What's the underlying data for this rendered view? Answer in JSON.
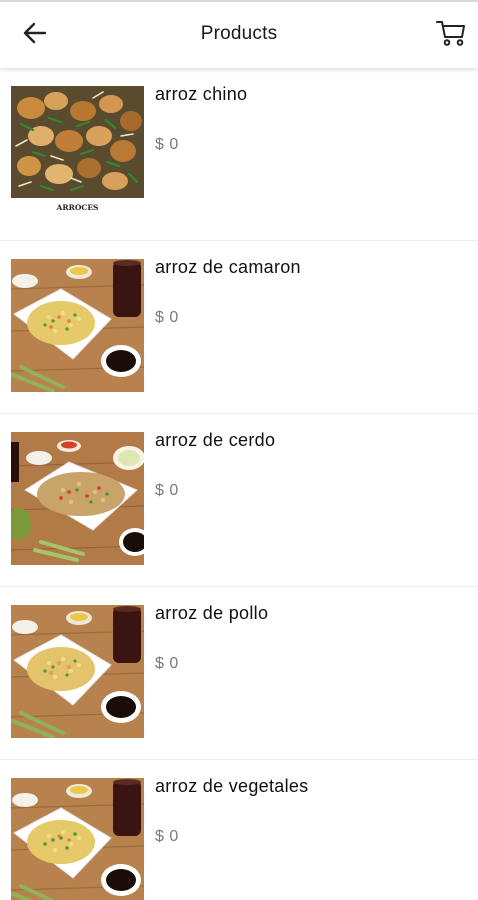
{
  "header": {
    "title": "Products",
    "back_icon": "arrow-left-icon",
    "cart_icon": "shopping-cart-icon"
  },
  "products": [
    {
      "name": "arroz chino",
      "price": "$ 0",
      "image": "fried-rice-stirfry",
      "caption": "ARROCES"
    },
    {
      "name": "arroz de camaron",
      "price": "$ 0",
      "image": "fried-rice-plate"
    },
    {
      "name": "arroz de cerdo",
      "price": "$ 0",
      "image": "fried-rice-bowl"
    },
    {
      "name": "arroz de pollo",
      "price": "$ 0",
      "image": "fried-rice-plate"
    },
    {
      "name": "arroz de vegetales",
      "price": "$ 0",
      "image": "fried-rice-plate"
    }
  ]
}
